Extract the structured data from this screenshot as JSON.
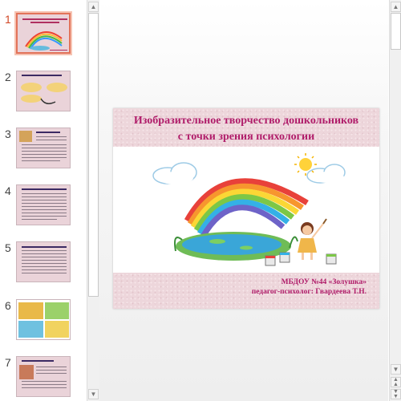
{
  "thumbnails": [
    {
      "number": "1",
      "active": true
    },
    {
      "number": "2",
      "active": false
    },
    {
      "number": "3",
      "active": false
    },
    {
      "number": "4",
      "active": false
    },
    {
      "number": "5",
      "active": false
    },
    {
      "number": "6",
      "active": false
    },
    {
      "number": "7",
      "active": false
    }
  ],
  "slide": {
    "title_line1": "Изобразительное творчество дошкольников",
    "title_line2": "с точки зрения психологии",
    "footer_line1": "МБДОУ №44 «Золушка»",
    "footer_line2": "педагог-психолог: Гвардеева Т.Н."
  },
  "icons": {
    "scroll_up": "triangle-up",
    "scroll_down": "triangle-down",
    "prev_slide": "double-chevron-up",
    "next_slide": "double-chevron-down"
  },
  "colors": {
    "accent": "#d24726",
    "title": "#b01d6a",
    "slide_band": "#edd6db"
  }
}
